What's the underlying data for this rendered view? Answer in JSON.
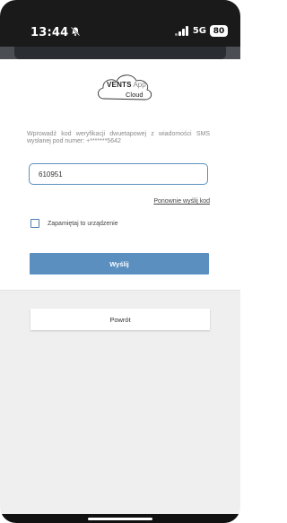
{
  "status_bar": {
    "time": "13:44",
    "network": "5G",
    "battery": "80",
    "icons": [
      "bell-off-icon",
      "signal-icon",
      "battery-icon"
    ]
  },
  "logo": {
    "brand": "VENTS",
    "app": "App",
    "cloud": "Cloud"
  },
  "verification": {
    "instruction": "Wprowadź kod weryfikacji dwuetapowej z wiadomości SMS wysłanej pod numer: +*******5642",
    "code_value": "610951",
    "resend_label": "Ponownie wyślij kod",
    "remember_label": "Zapamiętaj to urządzenie",
    "remember_checked": false,
    "send_label": "Wyślij",
    "back_label": "Powrót"
  },
  "colors": {
    "accent": "#5b8fc0",
    "status_bar_bg": "#1a1a1a",
    "lower_bg": "#efefef"
  }
}
